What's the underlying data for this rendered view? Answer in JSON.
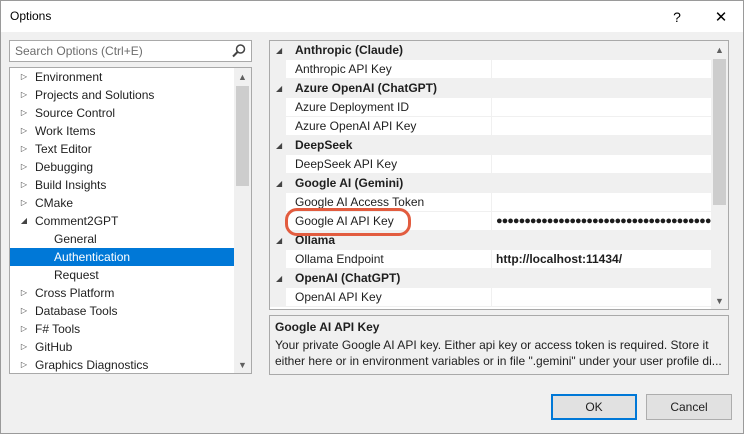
{
  "window": {
    "title": "Options",
    "help_glyph": "?",
    "close_glyph": "✕"
  },
  "search": {
    "placeholder": "Search Options (Ctrl+E)"
  },
  "tree": {
    "items": [
      {
        "label": "Environment",
        "level": 0,
        "expanded": false
      },
      {
        "label": "Projects and Solutions",
        "level": 0,
        "expanded": false
      },
      {
        "label": "Source Control",
        "level": 0,
        "expanded": false
      },
      {
        "label": "Work Items",
        "level": 0,
        "expanded": false
      },
      {
        "label": "Text Editor",
        "level": 0,
        "expanded": false
      },
      {
        "label": "Debugging",
        "level": 0,
        "expanded": false
      },
      {
        "label": "Build Insights",
        "level": 0,
        "expanded": false
      },
      {
        "label": "CMake",
        "level": 0,
        "expanded": false
      },
      {
        "label": "Comment2GPT",
        "level": 0,
        "expanded": true
      },
      {
        "label": "General",
        "level": 1
      },
      {
        "label": "Authentication",
        "level": 1,
        "selected": true
      },
      {
        "label": "Request",
        "level": 1
      },
      {
        "label": "Cross Platform",
        "level": 0,
        "expanded": false
      },
      {
        "label": "Database Tools",
        "level": 0,
        "expanded": false
      },
      {
        "label": "F# Tools",
        "level": 0,
        "expanded": false
      },
      {
        "label": "GitHub",
        "level": 0,
        "expanded": false
      },
      {
        "label": "Graphics Diagnostics",
        "level": 0,
        "expanded": false
      }
    ]
  },
  "grid": {
    "rows": [
      {
        "type": "category",
        "label": "Anthropic (Claude)"
      },
      {
        "type": "prop",
        "name": "Anthropic API Key",
        "value": ""
      },
      {
        "type": "category",
        "label": "Azure OpenAI (ChatGPT)"
      },
      {
        "type": "prop",
        "name": "Azure Deployment ID",
        "value": ""
      },
      {
        "type": "prop",
        "name": "Azure OpenAI API Key",
        "value": ""
      },
      {
        "type": "category",
        "label": "DeepSeek"
      },
      {
        "type": "prop",
        "name": "DeepSeek API Key",
        "value": ""
      },
      {
        "type": "category",
        "label": "Google AI (Gemini)"
      },
      {
        "type": "prop",
        "name": "Google AI Access Token",
        "value": ""
      },
      {
        "type": "prop",
        "name": "Google AI API Key",
        "value": "●●●●●●●●●●●●●●●●●●●●●●●●●●●●●●●●●●●●●●",
        "masked": true
      },
      {
        "type": "category",
        "label": "Ollama"
      },
      {
        "type": "prop",
        "name": "Ollama Endpoint",
        "value": "http://localhost:11434/"
      },
      {
        "type": "category",
        "label": "OpenAI (ChatGPT)"
      },
      {
        "type": "prop",
        "name": "OpenAI API Key",
        "value": ""
      }
    ]
  },
  "description": {
    "title": "Google AI API Key",
    "body": "Your private Google AI API key. Either api key or access token is required. Store it either here or in environment variables or in file \".gemini\" under your user profile di..."
  },
  "buttons": {
    "ok": "OK",
    "cancel": "Cancel"
  },
  "colors": {
    "selection": "#0078d7",
    "highlight_ring": "#e25c3f"
  }
}
